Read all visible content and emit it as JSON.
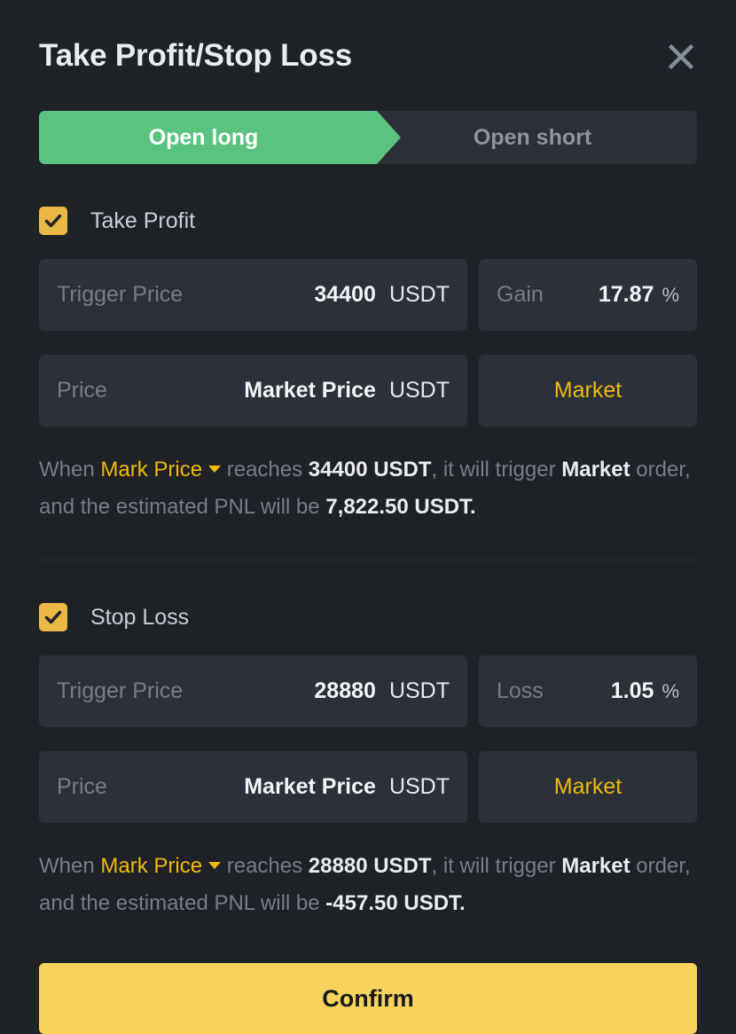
{
  "dialog": {
    "title": "Take Profit/Stop Loss",
    "close_icon": "close-icon"
  },
  "tabs": [
    {
      "label": "Open long",
      "active": true,
      "color": "#5ac37f"
    },
    {
      "label": "Open short",
      "active": false
    }
  ],
  "take_profit": {
    "checkbox_label": "Take Profit",
    "checked": true,
    "trigger_price": {
      "label": "Trigger Price",
      "value": "34400",
      "unit": "USDT"
    },
    "gain": {
      "label": "Gain",
      "value": "17.87",
      "unit": "%"
    },
    "price": {
      "label": "Price",
      "value": "Market Price",
      "unit": "USDT"
    },
    "order_type_button": "Market",
    "description": {
      "when": "When",
      "source": "Mark Price",
      "reaches": "reaches",
      "trigger_value": "34400 USDT",
      "will_trigger": ", it will trigger",
      "order_type": "Market",
      "order_tail": "order, and the estimated PNL will be",
      "pnl": "7,822.50 USDT."
    }
  },
  "stop_loss": {
    "checkbox_label": "Stop Loss",
    "checked": true,
    "trigger_price": {
      "label": "Trigger Price",
      "value": "28880",
      "unit": "USDT"
    },
    "loss": {
      "label": "Loss",
      "value": "1.05",
      "unit": "%"
    },
    "price": {
      "label": "Price",
      "value": "Market Price",
      "unit": "USDT"
    },
    "order_type_button": "Market",
    "description": {
      "when": "When",
      "source": "Mark Price",
      "reaches": "reaches",
      "trigger_value": "28880 USDT",
      "will_trigger": ", it will trigger",
      "order_type": "Market",
      "order_tail": "order, and the estimated PNL will be",
      "pnl": "-457.50 USDT."
    }
  },
  "footer": {
    "confirm_label": "Confirm"
  },
  "colors": {
    "background": "#1e2126",
    "field": "#2b3039",
    "accent_yellow": "#f0b90b",
    "confirm_yellow": "#f6d35d",
    "long_green": "#5ac37f",
    "text_primary": "#eaecef",
    "text_muted": "#767e8a"
  }
}
